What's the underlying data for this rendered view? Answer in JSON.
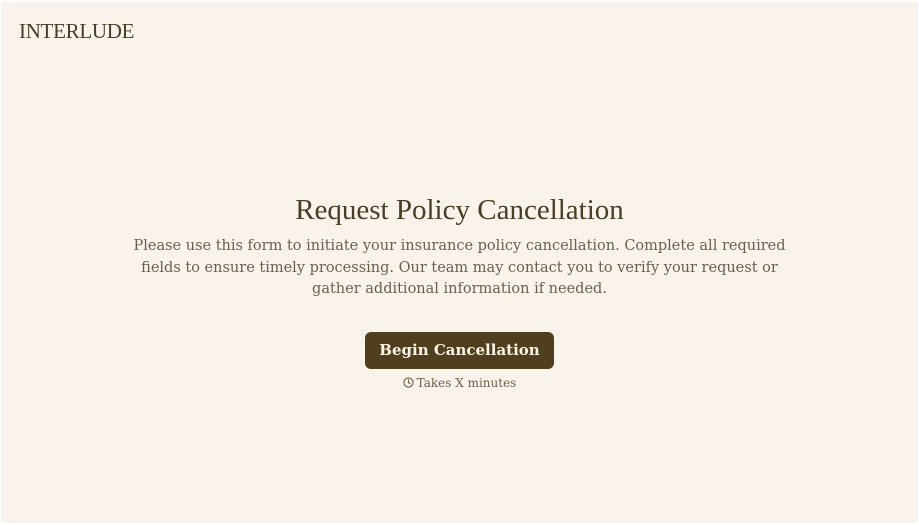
{
  "brand": {
    "name": "INTERLUDE"
  },
  "hero": {
    "title": "Request Policy Cancellation",
    "description": "Please use this form to initiate your insurance policy cancellation. Complete all required fields to ensure timely processing. Our team may contact you to verify your request or gather additional information if needed.",
    "cta_label": "Begin Cancellation",
    "duration_text": "Takes X minutes",
    "duration_icon": "clock-icon"
  },
  "colors": {
    "background": "#faf3ec",
    "text_primary": "#4a3d25",
    "text_secondary": "#6b5f4c",
    "button_bg": "#4f3f1f",
    "button_text": "#fbf3e6"
  }
}
